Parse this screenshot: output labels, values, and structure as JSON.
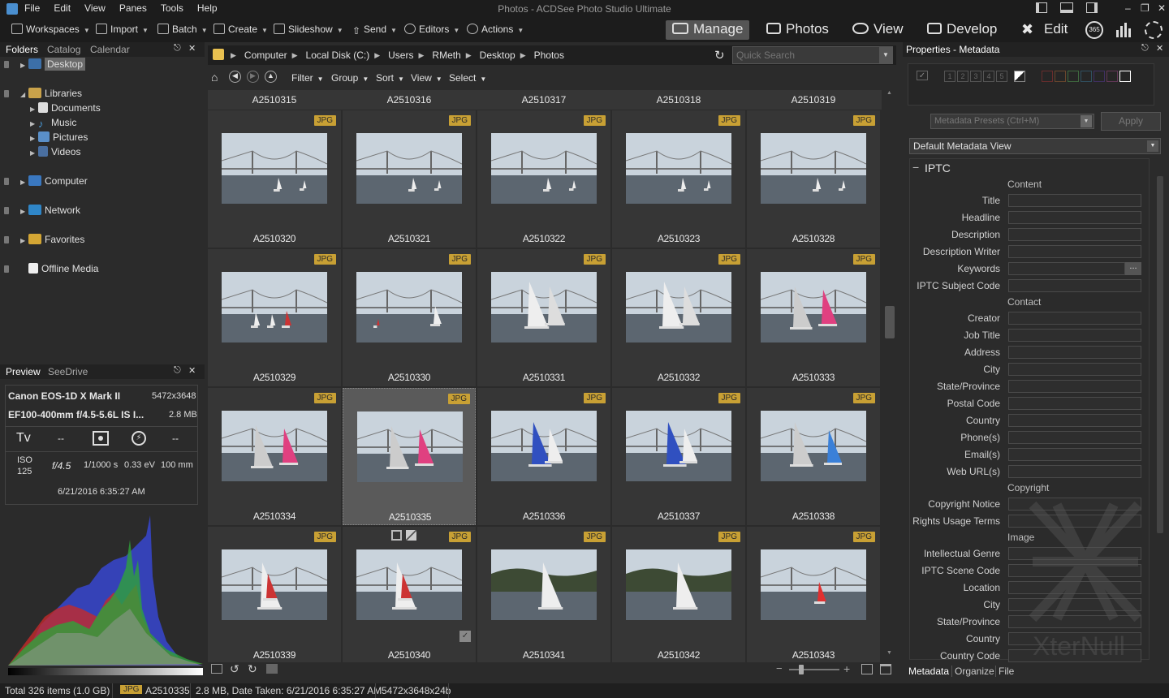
{
  "window": {
    "title": "Photos - ACDSee Photo Studio Ultimate"
  },
  "menu": [
    "File",
    "Edit",
    "View",
    "Panes",
    "Tools",
    "Help"
  ],
  "toolbar": {
    "workspaces": "Workspaces",
    "import": "Import",
    "batch": "Batch",
    "create": "Create",
    "slideshow": "Slideshow",
    "send": "Send",
    "editors": "Editors",
    "actions": "Actions"
  },
  "modes": {
    "manage": "Manage",
    "photos": "Photos",
    "view": "View",
    "develop": "Develop",
    "edit": "Edit",
    "badge365": "365"
  },
  "left_panel": {
    "tabs": [
      "Folders",
      "Catalog",
      "Calendar"
    ],
    "tree": {
      "desktop": "Desktop",
      "libraries": "Libraries",
      "documents": "Documents",
      "music": "Music",
      "pictures": "Pictures",
      "videos": "Videos",
      "computer": "Computer",
      "network": "Network",
      "favorites": "Favorites",
      "offline": "Offline Media"
    }
  },
  "preview": {
    "tabs": [
      "Preview",
      "SeeDrive"
    ],
    "camera": "Canon EOS-1D X Mark II",
    "dimensions": "5472x3648",
    "lens": "EF100-400mm f/4.5-5.6L IS I...",
    "size": "2.8 MB",
    "mode": "Tv",
    "dash1": "--",
    "dash2": "--",
    "iso_label": "ISO",
    "iso": "125",
    "aperture": "f/4.5",
    "shutter": "1/1000 s",
    "ev": "0.33 eV",
    "focal": "100 mm",
    "date": "6/21/2016 6:35:27 AM"
  },
  "breadcrumb": [
    "Computer",
    "Local Disk (C:)",
    "Users",
    "RMeth",
    "Desktop",
    "Photos"
  ],
  "search": {
    "placeholder": "Quick Search"
  },
  "filterbar": {
    "filter": "Filter",
    "group": "Group",
    "sort": "Sort",
    "view": "View",
    "select": "Select"
  },
  "grid": {
    "header_row": [
      "A2510315",
      "A2510316",
      "A2510317",
      "A2510318",
      "A2510319"
    ],
    "rows": [
      [
        "A2510320",
        "A2510321",
        "A2510322",
        "A2510323",
        "A2510328"
      ],
      [
        "A2510329",
        "A2510330",
        "A2510331",
        "A2510332",
        "A2510333"
      ],
      [
        "A2510334",
        "A2510335",
        "A2510336",
        "A2510337",
        "A2510338"
      ],
      [
        "A2510339",
        "A2510340",
        "A2510341",
        "A2510342",
        "A2510343"
      ]
    ],
    "badge": "JPG",
    "selected": "A2510335"
  },
  "right_panel": {
    "title": "Properties - Metadata",
    "presets_placeholder": "Metadata Presets (Ctrl+M)",
    "apply": "Apply",
    "view_select": "Default Metadata View",
    "section": "IPTC",
    "content_label": "Content",
    "content": [
      "Title",
      "Headline",
      "Description",
      "Description Writer",
      "Keywords",
      "IPTC Subject Code"
    ],
    "contact_label": "Contact",
    "contact": [
      "Creator",
      "Job Title",
      "Address",
      "City",
      "State/Province",
      "Postal Code",
      "Country",
      "Phone(s)",
      "Email(s)",
      "Web URL(s)"
    ],
    "copyright_label": "Copyright",
    "copyright": [
      "Copyright Notice",
      "Rights Usage Terms"
    ],
    "image_label": "Image",
    "image": [
      "Intellectual Genre",
      "IPTC Scene Code",
      "Location",
      "City",
      "State/Province",
      "Country",
      "Country Code"
    ],
    "bottom_tabs": [
      "Metadata",
      "Organize",
      "File"
    ],
    "rating_digits": [
      "1",
      "2",
      "3",
      "4",
      "5"
    ],
    "watermark": "XterNull"
  },
  "status": {
    "total": "Total 326 items  (1.0 GB)",
    "badge": "JPG",
    "file": "A2510335",
    "info": "2.8 MB, Date Taken: 6/21/2016 6:35:27 AM",
    "dims": "5472x3648x24b"
  }
}
